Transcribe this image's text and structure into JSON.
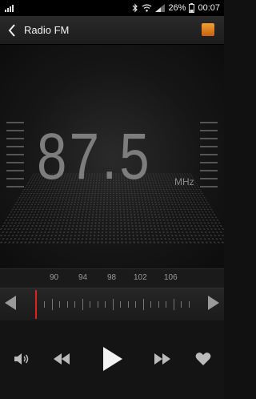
{
  "status_bar": {
    "battery_percent": "26%",
    "time": "00:07"
  },
  "app_bar": {
    "title": "Radio FM"
  },
  "radio": {
    "frequency": "87.5",
    "unit": "MHz"
  },
  "tuner": {
    "labels": [
      "90",
      "94",
      "98",
      "102",
      "106"
    ],
    "current_frequency": 87.5
  },
  "icons": {
    "back": "chevron-left-icon",
    "volume": "speaker-icon",
    "rewind": "rewind-icon",
    "play": "play-icon",
    "forward": "fast-forward-icon",
    "favorite": "heart-icon"
  },
  "colors": {
    "needle": "#d22222",
    "frequency_text": "#7d7d7d"
  }
}
